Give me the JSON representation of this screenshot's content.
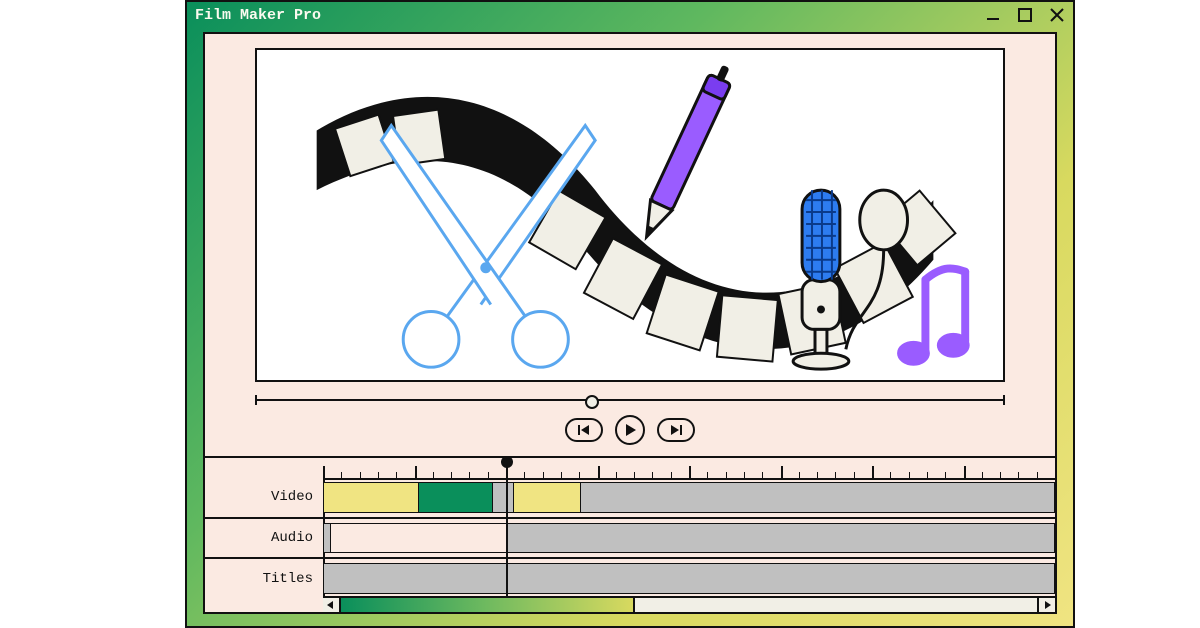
{
  "window": {
    "title": "Film Maker Pro"
  },
  "tracks": {
    "video": "Video",
    "audio": "Audio",
    "titles": "Titles"
  }
}
